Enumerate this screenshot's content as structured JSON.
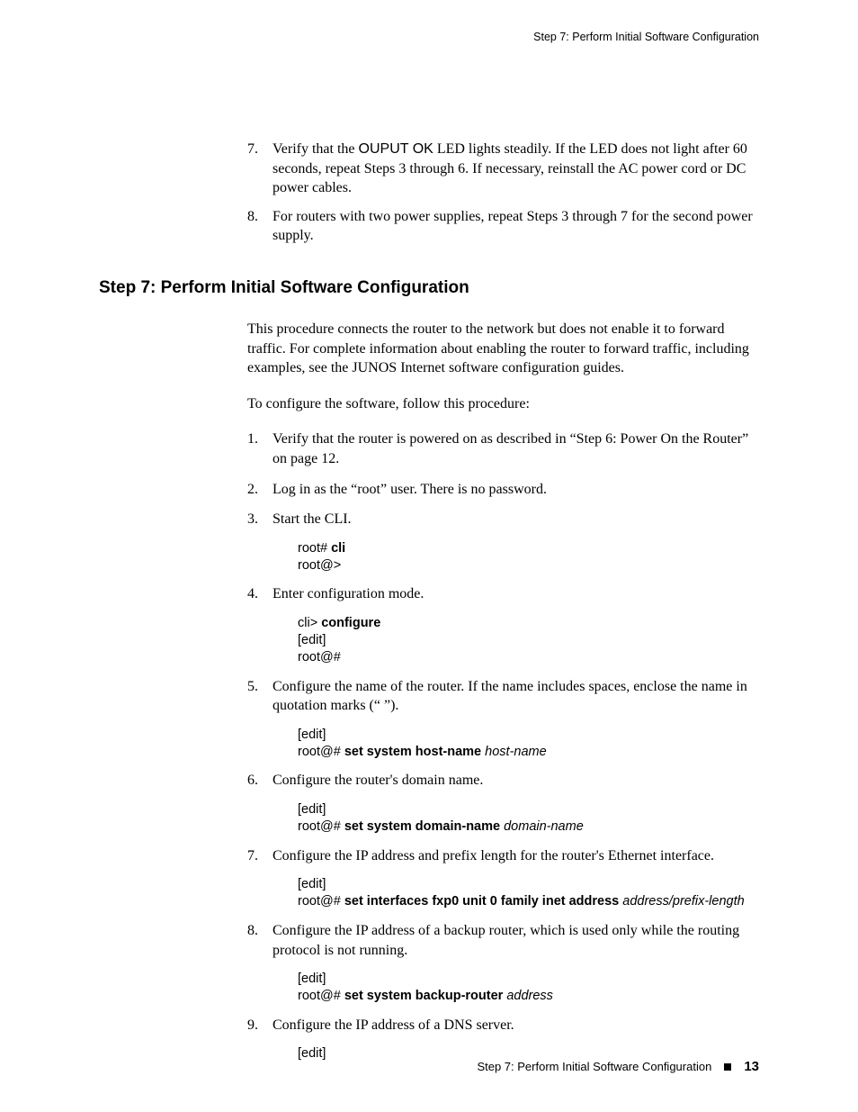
{
  "runningHead": "Step 7: Perform Initial Software Configuration",
  "topList": {
    "item7": {
      "num": "7.",
      "pre": "Verify that the ",
      "bold": "OUPUT OK",
      "post": " LED lights steadily. If the LED does not light after 60 seconds, repeat Steps 3 through 6. If necessary, reinstall the AC power cord or DC power cables."
    },
    "item8": {
      "num": "8.",
      "text": "For routers with two power supplies, repeat Steps 3 through 7 for the second power supply."
    }
  },
  "heading": "Step 7: Perform Initial Software Configuration",
  "intro1": "This procedure connects the router to the network but does not enable it to forward traffic. For complete information about enabling the router to forward traffic, including examples, see the JUNOS Internet software configuration guides.",
  "intro2": "To configure the software, follow this procedure:",
  "steps": {
    "s1": {
      "num": "1.",
      "text": "Verify that the router is powered on as described in “Step 6: Power On the Router” on page 12."
    },
    "s2": {
      "num": "2.",
      "text": "Log in as the “root” user. There is no password."
    },
    "s3": {
      "num": "3.",
      "text": "Start the CLI.",
      "code": {
        "l1a": "root# ",
        "l1b": "cli",
        "l2": "root@>"
      }
    },
    "s4": {
      "num": "4.",
      "text": "Enter configuration mode.",
      "code": {
        "l1a": "cli> ",
        "l1b": "configure",
        "l2": "[edit]",
        "l3": "root@#"
      }
    },
    "s5": {
      "num": "5.",
      "text": "Configure the name of the router. If the name includes spaces, enclose the name in quotation marks (“ ”).",
      "code": {
        "l1": "[edit]",
        "l2a": "root@# ",
        "l2b": "set system host-name ",
        "l2c": "host-name"
      }
    },
    "s6": {
      "num": "6.",
      "text": "Configure the router's domain name.",
      "code": {
        "l1": "[edit]",
        "l2a": "root@# ",
        "l2b": "set system domain-name ",
        "l2c": "domain-name"
      }
    },
    "s7": {
      "num": "7.",
      "text": "Configure the IP address and prefix length for the router's Ethernet interface.",
      "code": {
        "l1": "[edit]",
        "l2a": "root@# ",
        "l2b": "set interfaces fxp0 unit 0 family inet address ",
        "l2c": "address/prefix-length"
      }
    },
    "s8": {
      "num": "8.",
      "text": "Configure the IP address of a backup router, which is used only while the routing protocol is not running.",
      "code": {
        "l1": "[edit]",
        "l2a": "root@# ",
        "l2b": "set system backup-router ",
        "l2c": "address"
      }
    },
    "s9": {
      "num": "9.",
      "text": "Configure the IP address of a DNS server.",
      "code": {
        "l1": "[edit]"
      }
    }
  },
  "footer": {
    "text": "Step 7: Perform Initial Software Configuration",
    "page": "13"
  }
}
